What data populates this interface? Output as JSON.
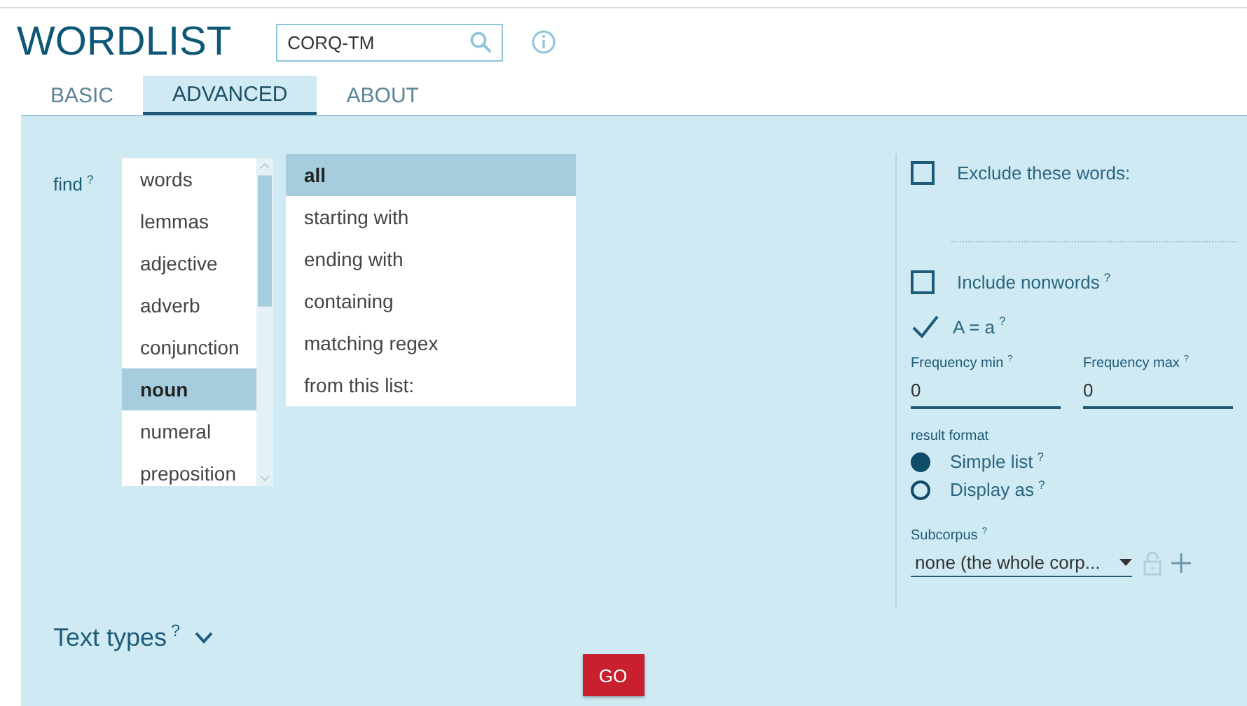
{
  "app": {
    "title": "WORDLIST"
  },
  "corpus_search": {
    "value": "CORQ-TM"
  },
  "tabs": [
    {
      "label": "BASIC",
      "selected": false
    },
    {
      "label": "ADVANCED",
      "selected": true
    },
    {
      "label": "ABOUT",
      "selected": false
    }
  ],
  "find": {
    "label": "find$^{?}$",
    "types": [
      {
        "label": "words",
        "selected": false
      },
      {
        "label": "lemmas",
        "selected": false
      },
      {
        "label": "adjective",
        "selected": false
      },
      {
        "label": "adverb",
        "selected": false
      },
      {
        "label": "conjunction",
        "selected": false
      },
      {
        "label": "noun",
        "selected": true
      },
      {
        "label": "numeral",
        "selected": false
      },
      {
        "label": "preposition",
        "selected": false
      }
    ],
    "criteria": [
      {
        "label": "all",
        "selected": true
      },
      {
        "label": "starting with",
        "selected": false
      },
      {
        "label": "ending with",
        "selected": false
      },
      {
        "label": "containing",
        "selected": false
      },
      {
        "label": "matching regex",
        "selected": false
      },
      {
        "label": "from this list:",
        "selected": false
      }
    ]
  },
  "options": {
    "exclude": {
      "label": "Exclude these words:",
      "checked": false
    },
    "nonwords": {
      "label": "Include nonwords$^{?}$",
      "checked": false
    },
    "case": {
      "label": "A = a$^{?}$",
      "checked": true
    },
    "freq_min": {
      "label": "Frequency min$^{?}$",
      "value": "0"
    },
    "freq_max": {
      "label": "Frequency max$^{?}$",
      "value": "0"
    },
    "result_format": {
      "label": "result format",
      "options": [
        {
          "label": "Simple list$^{?}$",
          "selected": true
        },
        {
          "label": "Display as$^{?}$",
          "selected": false
        }
      ]
    },
    "subcorpus": {
      "label": "Subcorpus$^{?}$",
      "value": "none (the whole corp..."
    }
  },
  "text_types": {
    "label": "Text types$^{?}$",
    "expanded": false
  },
  "go_button": "GO"
}
